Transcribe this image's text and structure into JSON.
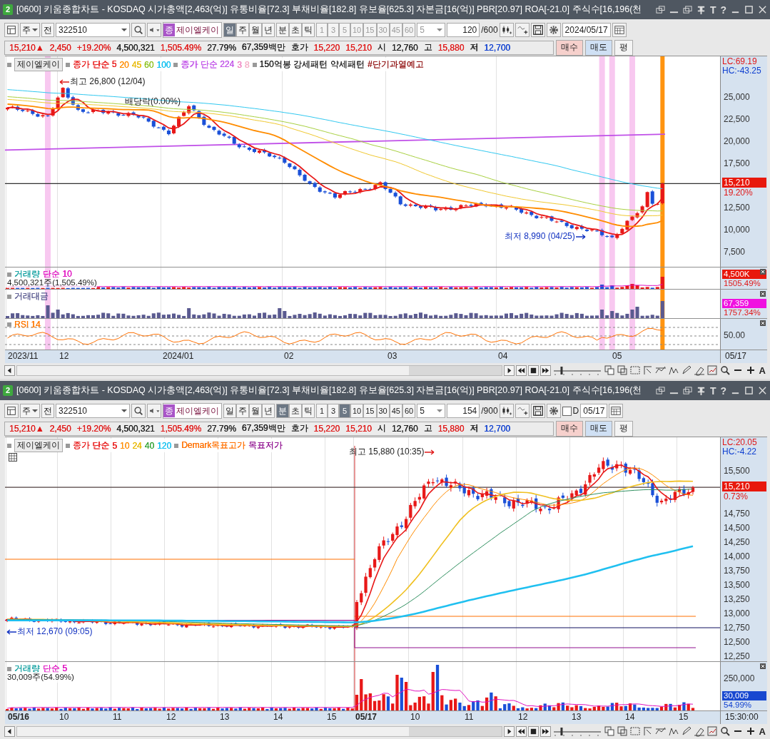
{
  "windows": [
    {
      "badge": "2",
      "title": "[0600] 키움종합차트 - KOSDAQ 시가총액[2,463(억)] 유통비율[72.3] 부채비율[182.8] 유보율[625.3] 자본금[16(억)] PBR[20.97] ROA[-21.0] 주식수[16,196(천",
      "title_buttons": [
        "T",
        "?"
      ],
      "toolbar": {
        "market": "주",
        "prev": "전",
        "code": "322510",
        "name_badge": "종",
        "name": "제이엘케이",
        "periods": [
          {
            "label": "일",
            "selected": true
          },
          {
            "label": "주",
            "selected": false
          },
          {
            "label": "월",
            "selected": false
          },
          {
            "label": "년",
            "selected": false
          }
        ],
        "units": [
          {
            "label": "분",
            "selected": false
          },
          {
            "label": "초",
            "selected": false
          },
          {
            "label": "틱",
            "selected": false
          }
        ],
        "intervals_enabled": false,
        "intervals": [
          {
            "label": "1",
            "selected": false
          },
          {
            "label": "3",
            "selected": false
          },
          {
            "label": "5",
            "selected": false
          },
          {
            "label": "10",
            "selected": false
          },
          {
            "label": "15",
            "selected": false
          },
          {
            "label": "30",
            "selected": false
          },
          {
            "label": "45",
            "selected": false
          },
          {
            "label": "60",
            "selected": false
          }
        ],
        "interval_select": "5",
        "count": "120",
        "count_max": "/600",
        "date": "2024/05/17"
      },
      "quote": {
        "items": [
          {
            "text": "15,210▲",
            "color": "#e01818"
          },
          {
            "text": "2,450",
            "color": "#e01818"
          },
          {
            "text": "+19.20%",
            "color": "#e01818"
          },
          {
            "text": "4,500,321",
            "color": "#222222"
          },
          {
            "text": "1,505.49%",
            "color": "#e01818"
          },
          {
            "text": "27.79%",
            "color": "#222222"
          },
          {
            "text": "67,359백만",
            "color": "#222222"
          },
          {
            "text": "호가",
            "color": "#222222"
          },
          {
            "text": "15,220",
            "color": "#e01818"
          },
          {
            "text": "15,210",
            "color": "#e01818"
          },
          {
            "text": "시",
            "color": "#222222"
          },
          {
            "text": "12,760",
            "color": "#222222"
          },
          {
            "text": "고",
            "color": "#222222"
          },
          {
            "text": "15,880",
            "color": "#e01818"
          },
          {
            "text": "저",
            "color": "#222222"
          },
          {
            "text": "12,700",
            "color": "#1040d0"
          }
        ],
        "buttons": [
          {
            "text": "매수",
            "kind": "buy"
          },
          {
            "text": "매도",
            "kind": "sell"
          },
          {
            "text": "평",
            "kind": "plain"
          }
        ]
      },
      "legend": {
        "name_button": "제이엘케이",
        "groups": [
          [
            {
              "text": "종가 단순 5",
              "color": "#e81818"
            },
            {
              "text": "20",
              "color": "#ff8c00"
            },
            {
              "text": "45",
              "color": "#e8b800"
            },
            {
              "text": "60",
              "color": "#8cc01c"
            },
            {
              "text": "100",
              "color": "#10c0f0"
            }
          ],
          [
            {
              "text": "종가 단순 224",
              "color": "#c050e8"
            },
            {
              "text": "3",
              "color": "#f080c0"
            },
            {
              "text": "8",
              "color": "#f4b0c8"
            }
          ],
          [
            {
              "text": "150억봉 강세패턴",
              "color": "#202020"
            },
            {
              "text": "약세패턴",
              "color": "#202020"
            },
            {
              "text": "#단기과열예고",
              "color": "#901010"
            }
          ]
        ]
      },
      "annotations": [
        {
          "text": "최고 26,800 (12/04)",
          "kind": "high"
        },
        {
          "text": "배당락(0.00%)",
          "kind": "note"
        },
        {
          "text": "최저 8,990 (04/25)",
          "kind": "low"
        }
      ],
      "price_axis": {
        "lc": "LC:69.19",
        "hc": "HC:-43.25",
        "ticks": [
          "25,000",
          "22,500",
          "20,000",
          "17,500",
          "12,500",
          "10,000",
          "7,500"
        ],
        "last_price": "15,210",
        "last_change": "19.20%"
      },
      "panes": [
        {
          "kind": "volume",
          "legend": [
            {
              "text": "거래량",
              "color": "#10a0a0"
            },
            {
              "text": "단순 10",
              "color": "#e010c0"
            }
          ],
          "reading": "4,500,321주(1,505.49%)",
          "tags": [
            {
              "text": "4,500K",
              "color": "#e8180c",
              "filled": true
            },
            {
              "text": "1505.49%",
              "color": "#e01818",
              "filled": false
            }
          ]
        },
        {
          "kind": "amount",
          "legend": [
            {
              "text": "거래대금",
              "color": "#5a5a90"
            }
          ],
          "tags": [
            {
              "text": "67,359",
              "color": "#f010e0",
              "filled": true
            },
            {
              "text": "1757.34%",
              "color": "#e01818",
              "filled": false
            }
          ]
        },
        {
          "kind": "rsi",
          "legend": [
            {
              "text": "RSI 14",
              "color": "#ff7800"
            }
          ],
          "ticks": [
            "50.00"
          ]
        }
      ],
      "x_axis": {
        "labels": [
          {
            "text": "2023/11",
            "major": false
          },
          {
            "text": "12",
            "major": false
          },
          {
            "text": "2024/01",
            "major": false
          },
          {
            "text": "02",
            "major": false
          },
          {
            "text": "03",
            "major": false
          },
          {
            "text": "04",
            "major": false
          },
          {
            "text": "05",
            "major": false
          }
        ],
        "end_label": "05/17"
      },
      "zoom": {
        "level": 0.15
      },
      "font_button": "A"
    },
    {
      "badge": "2",
      "title": "[0600] 키움종합차트 - KOSDAQ 시가총액[2,463(억)] 유통비율[72.3] 부채비율[182.8] 유보율[625.3] 자본금[16(억)] PBR[20.97] ROA[-21.0] 주식수[16,196(천",
      "title_buttons": [
        "T",
        "?"
      ],
      "toolbar": {
        "market": "주",
        "prev": "전",
        "code": "322510",
        "name_badge": "종",
        "name": "제이엘케이",
        "periods": [
          {
            "label": "일",
            "selected": false
          },
          {
            "label": "주",
            "selected": false
          },
          {
            "label": "월",
            "selected": false
          },
          {
            "label": "년",
            "selected": false
          }
        ],
        "units": [
          {
            "label": "분",
            "selected": true
          },
          {
            "label": "초",
            "selected": false
          },
          {
            "label": "틱",
            "selected": false
          }
        ],
        "intervals_enabled": true,
        "intervals": [
          {
            "label": "1",
            "selected": false
          },
          {
            "label": "3",
            "selected": false
          },
          {
            "label": "5",
            "selected": true
          },
          {
            "label": "10",
            "selected": false
          },
          {
            "label": "15",
            "selected": false
          },
          {
            "label": "30",
            "selected": false
          },
          {
            "label": "45",
            "selected": false
          },
          {
            "label": "60",
            "selected": false
          }
        ],
        "interval_select": "5",
        "count": "154",
        "count_max": "/900",
        "date_check": {
          "checked": false,
          "label": "D"
        },
        "date": "05/17"
      },
      "quote": {
        "items": [
          {
            "text": "15,210▲",
            "color": "#e01818"
          },
          {
            "text": "2,450",
            "color": "#e01818"
          },
          {
            "text": "+19.20%",
            "color": "#e01818"
          },
          {
            "text": "4,500,321",
            "color": "#222222"
          },
          {
            "text": "1,505.49%",
            "color": "#e01818"
          },
          {
            "text": "27.79%",
            "color": "#222222"
          },
          {
            "text": "67,359백만",
            "color": "#222222"
          },
          {
            "text": "호가",
            "color": "#222222"
          },
          {
            "text": "15,220",
            "color": "#e01818"
          },
          {
            "text": "15,210",
            "color": "#e01818"
          },
          {
            "text": "시",
            "color": "#222222"
          },
          {
            "text": "12,760",
            "color": "#222222"
          },
          {
            "text": "고",
            "color": "#222222"
          },
          {
            "text": "15,880",
            "color": "#e01818"
          },
          {
            "text": "저",
            "color": "#222222"
          },
          {
            "text": "12,700",
            "color": "#1040d0"
          }
        ],
        "buttons": [
          {
            "text": "매수",
            "kind": "buy"
          },
          {
            "text": "매도",
            "kind": "sell"
          },
          {
            "text": "평",
            "kind": "plain"
          }
        ]
      },
      "legend": {
        "name_button": "제이엘케이",
        "groups": [
          [
            {
              "text": "종가 단순",
              "color": "#e81818"
            },
            {
              "text": "5",
              "color": "#e81818"
            },
            {
              "text": "10",
              "color": "#ff8c00"
            },
            {
              "text": "24",
              "color": "#e8b800"
            },
            {
              "text": "40",
              "color": "#30a030"
            },
            {
              "text": "120",
              "color": "#10c0f0"
            }
          ],
          [
            {
              "text": "Demark목표고가",
              "color": "#ff7000"
            },
            {
              "text": "목표저가",
              "color": "#901090"
            }
          ]
        ]
      },
      "annotations": [
        {
          "text": "최고 15,880 (10:35)",
          "kind": "high"
        },
        {
          "text": "최저 12,670 (09:05)",
          "kind": "low"
        }
      ],
      "price_axis": {
        "lc": "LC:20.05",
        "hc": "HC:-4.22",
        "ticks": [
          "15,500",
          "14,750",
          "14,500",
          "14,250",
          "14,000",
          "13,750",
          "13,500",
          "13,250",
          "13,000",
          "12,750",
          "12,500",
          "12,250"
        ],
        "last_price": "15,210",
        "last_change": "0.73%"
      },
      "panes": [
        {
          "kind": "volume",
          "legend": [
            {
              "text": "거래량",
              "color": "#10a0a0"
            },
            {
              "text": "단순 5",
              "color": "#e010c0"
            }
          ],
          "reading": "30,009주(54.99%)",
          "ticks": [
            "250,000"
          ],
          "tags": [
            {
              "text": "30,009",
              "color": "#1848d0",
              "filled": true
            },
            {
              "text": "54.99%",
              "color": "#1040d0",
              "filled": false
            }
          ]
        }
      ],
      "x_axis": {
        "labels": [
          {
            "text": "05/16",
            "major": true
          },
          {
            "text": "10",
            "major": false
          },
          {
            "text": "11",
            "major": false
          },
          {
            "text": "12",
            "major": false
          },
          {
            "text": "13",
            "major": false
          },
          {
            "text": "14",
            "major": false
          },
          {
            "text": "15",
            "major": false
          },
          {
            "text": "05/17",
            "major": true
          },
          {
            "text": "10",
            "major": false
          },
          {
            "text": "11",
            "major": false
          },
          {
            "text": "12",
            "major": false
          },
          {
            "text": "13",
            "major": false
          },
          {
            "text": "14",
            "major": false
          },
          {
            "text": "15",
            "major": false
          }
        ],
        "end_label": "15:30:00"
      },
      "zoom": {
        "level": 0.15
      },
      "font_button": "A"
    }
  ]
}
